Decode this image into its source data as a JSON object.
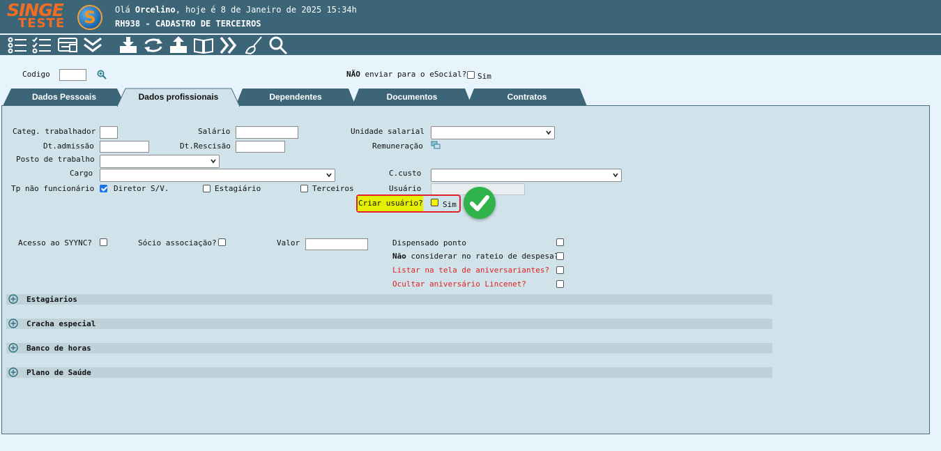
{
  "header": {
    "logo_top": "SINGE",
    "logo_bottom": "TESTE",
    "logo_s": "S",
    "greeting_prefix": "Olá ",
    "greeting_user": "Orcelino",
    "greeting_suffix": ", hoje é 8 de Janeiro de 2025 15:34h",
    "screen_title": "RH938 - CADASTRO DE TERCEIROS"
  },
  "toolbar": {
    "icons": [
      "list-icon",
      "checklist-icon",
      "card-icon",
      "double-chevron-down-icon",
      "download-icon",
      "refresh-icon",
      "upload-icon",
      "book-icon",
      "double-chevron-right-icon",
      "broom-icon",
      "search-icon"
    ]
  },
  "top_form": {
    "codigo_label": "Codigo",
    "codigo_value": "",
    "esocial_label_bold": "NÃO",
    "esocial_label_rest": " enviar para o eSocial?",
    "esocial_sim": "Sim"
  },
  "tabs": [
    {
      "label": "Dados Pessoais",
      "active": false
    },
    {
      "label": "Dados profissionais",
      "active": true
    },
    {
      "label": "Dependentes",
      "active": false
    },
    {
      "label": "Documentos",
      "active": false
    },
    {
      "label": "Contratos",
      "active": false
    }
  ],
  "form": {
    "categ_label": "Categ. trabalhador",
    "salario_label": "Salário",
    "unidade_label": "Unidade salarial",
    "dtadmissao_label": "Dt.admissão",
    "dtrescisao_label": "Dt.Rescisão",
    "remuneracao_label": "Remuneração",
    "posto_label": "Posto de trabalho",
    "cargo_label": "Cargo",
    "ccusto_label": "C.custo",
    "tp_label": "Tp não funcionário",
    "diretor_label": "Diretor S/V.",
    "diretor_checked": true,
    "estagiario_label": "Estagiário",
    "terceiros_label": "Terceiros",
    "usuario_label": "Usuário",
    "criar_label": "Criar usuário?",
    "criar_sim": "Sim",
    "acesso_label": "Acesso ao SYYNC?",
    "socio_label": "Sócio associação?",
    "valor_label": "Valor",
    "dispensado_label": "Dispensado ponto",
    "nao_considerar_bold": "Não",
    "nao_considerar_rest": " considerar no rateio de despesa?",
    "listar_label": "Listar na tela de aniversariantes?",
    "ocultar_label": "Ocultar aniversário Lincenet?"
  },
  "sections": [
    "Estagiarios",
    "Cracha especial",
    "Banco de horas",
    "Plano de Saúde"
  ],
  "colors": {
    "header_bg": "#3c6577",
    "page_bg": "#e8f4fb",
    "panel_bg": "#d0e3ea",
    "accent_orange": "#f26d21",
    "highlight_yellow": "#e5f000",
    "highlight_red": "#e0202a",
    "success_green": "#2fb34a",
    "warning_red_text": "#e02020"
  }
}
